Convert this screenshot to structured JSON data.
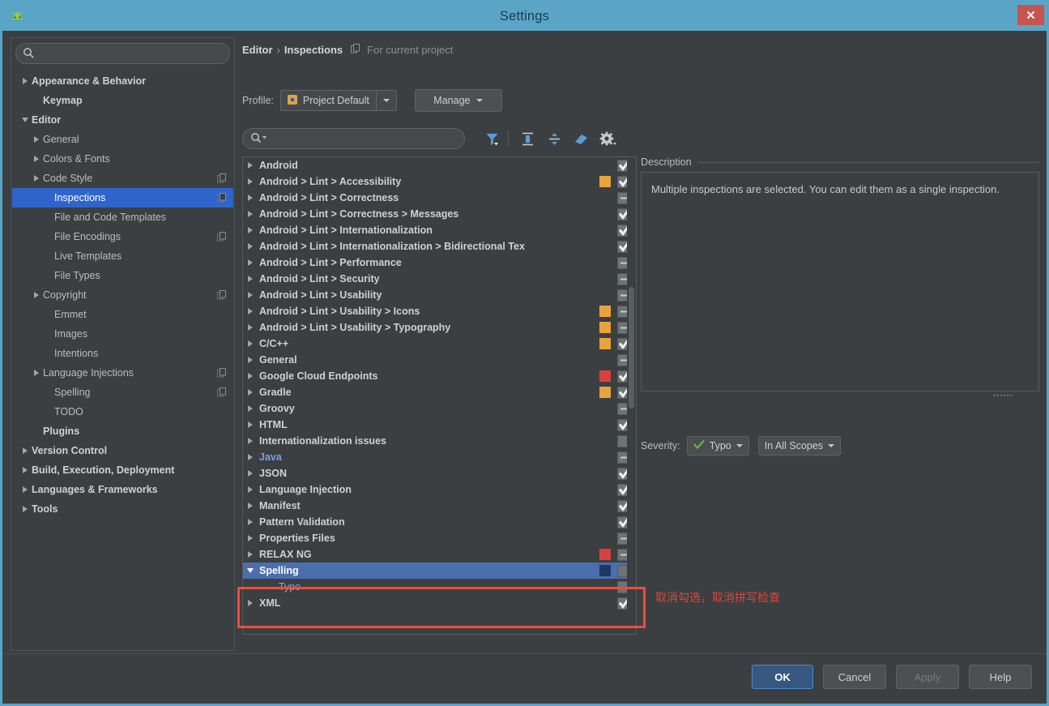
{
  "window": {
    "title": "Settings",
    "app_icon": "android-studio-icon",
    "close_label": "close-icon",
    "accent_title_bar": "#5aa5c6",
    "close_button_color": "#c75450"
  },
  "sidebar": {
    "search_placeholder": "",
    "search_value": "",
    "search_icon": "search-icon",
    "items": [
      {
        "label": "Appearance & Behavior",
        "indent": 0,
        "arrow": "right",
        "bold": true,
        "selected": false,
        "copy_icon": false
      },
      {
        "label": "Keymap",
        "indent": 1,
        "arrow": "none",
        "bold": true,
        "selected": false,
        "copy_icon": false
      },
      {
        "label": "Editor",
        "indent": 0,
        "arrow": "down",
        "bold": true,
        "selected": false,
        "copy_icon": false
      },
      {
        "label": "General",
        "indent": 1,
        "arrow": "right",
        "bold": false,
        "selected": false,
        "copy_icon": false
      },
      {
        "label": "Colors & Fonts",
        "indent": 1,
        "arrow": "right",
        "bold": false,
        "selected": false,
        "copy_icon": false
      },
      {
        "label": "Code Style",
        "indent": 1,
        "arrow": "right",
        "bold": false,
        "selected": false,
        "copy_icon": true
      },
      {
        "label": "Inspections",
        "indent": 2,
        "arrow": "none",
        "bold": false,
        "selected": true,
        "copy_icon": true
      },
      {
        "label": "File and Code Templates",
        "indent": 2,
        "arrow": "none",
        "bold": false,
        "selected": false,
        "copy_icon": false
      },
      {
        "label": "File Encodings",
        "indent": 2,
        "arrow": "none",
        "bold": false,
        "selected": false,
        "copy_icon": true
      },
      {
        "label": "Live Templates",
        "indent": 2,
        "arrow": "none",
        "bold": false,
        "selected": false,
        "copy_icon": false
      },
      {
        "label": "File Types",
        "indent": 2,
        "arrow": "none",
        "bold": false,
        "selected": false,
        "copy_icon": false
      },
      {
        "label": "Copyright",
        "indent": 1,
        "arrow": "right",
        "bold": false,
        "selected": false,
        "copy_icon": true
      },
      {
        "label": "Emmet",
        "indent": 2,
        "arrow": "none",
        "bold": false,
        "selected": false,
        "copy_icon": false
      },
      {
        "label": "Images",
        "indent": 2,
        "arrow": "none",
        "bold": false,
        "selected": false,
        "copy_icon": false
      },
      {
        "label": "Intentions",
        "indent": 2,
        "arrow": "none",
        "bold": false,
        "selected": false,
        "copy_icon": false
      },
      {
        "label": "Language Injections",
        "indent": 1,
        "arrow": "right",
        "bold": false,
        "selected": false,
        "copy_icon": true
      },
      {
        "label": "Spelling",
        "indent": 2,
        "arrow": "none",
        "bold": false,
        "selected": false,
        "copy_icon": true
      },
      {
        "label": "TODO",
        "indent": 2,
        "arrow": "none",
        "bold": false,
        "selected": false,
        "copy_icon": false
      },
      {
        "label": "Plugins",
        "indent": 1,
        "arrow": "none",
        "bold": true,
        "selected": false,
        "copy_icon": false
      },
      {
        "label": "Version Control",
        "indent": 0,
        "arrow": "right",
        "bold": true,
        "selected": false,
        "copy_icon": false
      },
      {
        "label": "Build, Execution, Deployment",
        "indent": 0,
        "arrow": "right",
        "bold": true,
        "selected": false,
        "copy_icon": false
      },
      {
        "label": "Languages & Frameworks",
        "indent": 0,
        "arrow": "right",
        "bold": true,
        "selected": false,
        "copy_icon": false
      },
      {
        "label": "Tools",
        "indent": 0,
        "arrow": "right",
        "bold": true,
        "selected": false,
        "copy_icon": false
      }
    ]
  },
  "header": {
    "crumb1": "Editor",
    "separator": "›",
    "crumb2": "Inspections",
    "scope_icon": "copy-icon",
    "scope_note": "For current project"
  },
  "profile": {
    "label": "Profile:",
    "icon": "profile-icon",
    "value": "Project Default",
    "dropdown_icon": "chevron-down-icon",
    "manage_label": "Manage"
  },
  "inspections_toolbar": {
    "search_value": "",
    "search_placeholder": "",
    "search_icon": "search-icon",
    "buttons": [
      {
        "name": "filter-icon",
        "title": "Filter"
      },
      {
        "name": "expand-all-icon",
        "title": "Expand All"
      },
      {
        "name": "collapse-all-icon",
        "title": "Collapse All"
      },
      {
        "name": "reset-eraser-icon",
        "title": "Reset to Defaults"
      },
      {
        "name": "gear-icon",
        "title": "Options"
      }
    ]
  },
  "inspection_tree": [
    {
      "label": "Android",
      "arrow": "right",
      "swatch": null,
      "check": "checked",
      "style": "normal"
    },
    {
      "label": "Android > Lint > Accessibility",
      "arrow": "right",
      "swatch": "#e8a33d",
      "check": "checked",
      "style": "normal"
    },
    {
      "label": "Android > Lint > Correctness",
      "arrow": "right",
      "swatch": null,
      "check": "partial",
      "style": "normal"
    },
    {
      "label": "Android > Lint > Correctness > Messages",
      "arrow": "right",
      "swatch": null,
      "check": "checked",
      "style": "normal"
    },
    {
      "label": "Android > Lint > Internationalization",
      "arrow": "right",
      "swatch": null,
      "check": "checked",
      "style": "normal"
    },
    {
      "label": "Android > Lint > Internationalization > Bidirectional Tex",
      "arrow": "right",
      "swatch": null,
      "check": "checked",
      "style": "normal"
    },
    {
      "label": "Android > Lint > Performance",
      "arrow": "right",
      "swatch": null,
      "check": "partial",
      "style": "normal"
    },
    {
      "label": "Android > Lint > Security",
      "arrow": "right",
      "swatch": null,
      "check": "partial",
      "style": "normal"
    },
    {
      "label": "Android > Lint > Usability",
      "arrow": "right",
      "swatch": null,
      "check": "partial",
      "style": "normal"
    },
    {
      "label": "Android > Lint > Usability > Icons",
      "arrow": "right",
      "swatch": "#e8a33d",
      "check": "partial",
      "style": "normal"
    },
    {
      "label": "Android > Lint > Usability > Typography",
      "arrow": "right",
      "swatch": "#e8a33d",
      "check": "partial",
      "style": "normal"
    },
    {
      "label": "C/C++",
      "arrow": "right",
      "swatch": "#e8a33d",
      "check": "checked",
      "style": "normal"
    },
    {
      "label": "General",
      "arrow": "right",
      "swatch": null,
      "check": "partial",
      "style": "normal"
    },
    {
      "label": "Google Cloud Endpoints",
      "arrow": "right",
      "swatch": "#d9413c",
      "check": "checked",
      "style": "normal"
    },
    {
      "label": "Gradle",
      "arrow": "right",
      "swatch": "#e8a33d",
      "check": "checked",
      "style": "normal"
    },
    {
      "label": "Groovy",
      "arrow": "right",
      "swatch": null,
      "check": "partial",
      "style": "normal"
    },
    {
      "label": "HTML",
      "arrow": "right",
      "swatch": null,
      "check": "checked",
      "style": "normal"
    },
    {
      "label": "Internationalization issues",
      "arrow": "right",
      "swatch": null,
      "check": "empty",
      "style": "normal"
    },
    {
      "label": "Java",
      "arrow": "right",
      "swatch": null,
      "check": "partial",
      "style": "java"
    },
    {
      "label": "JSON",
      "arrow": "right",
      "swatch": null,
      "check": "checked",
      "style": "normal"
    },
    {
      "label": "Language Injection",
      "arrow": "right",
      "swatch": null,
      "check": "checked",
      "style": "normal"
    },
    {
      "label": "Manifest",
      "arrow": "right",
      "swatch": null,
      "check": "checked",
      "style": "normal"
    },
    {
      "label": "Pattern Validation",
      "arrow": "right",
      "swatch": null,
      "check": "checked",
      "style": "normal"
    },
    {
      "label": "Properties Files",
      "arrow": "right",
      "swatch": null,
      "check": "partial",
      "style": "normal"
    },
    {
      "label": "RELAX NG",
      "arrow": "right",
      "swatch": "#d9413c",
      "check": "partial",
      "style": "normal"
    },
    {
      "label": "Spelling",
      "arrow": "down",
      "swatch": "#1d3a5e",
      "check": "empty",
      "style": "selected"
    },
    {
      "label": "Typo",
      "arrow": "none",
      "swatch": null,
      "check": "empty",
      "style": "child"
    },
    {
      "label": "XML",
      "arrow": "right",
      "swatch": null,
      "check": "checked",
      "style": "normal"
    }
  ],
  "description": {
    "legend": "Description",
    "text": "Multiple inspections are selected. You can edit them as a single inspection."
  },
  "severity": {
    "label": "Severity:",
    "icon": "typo-check-icon",
    "value": "Typo",
    "scope_value": "In All Scopes",
    "dropdown_icon": "chevron-down-icon"
  },
  "annotation": {
    "text": "取消勾选，取消拼写检查",
    "color": "#e0453a"
  },
  "footer": {
    "ok": "OK",
    "cancel": "Cancel",
    "apply": "Apply",
    "help": "Help",
    "apply_disabled": true
  }
}
